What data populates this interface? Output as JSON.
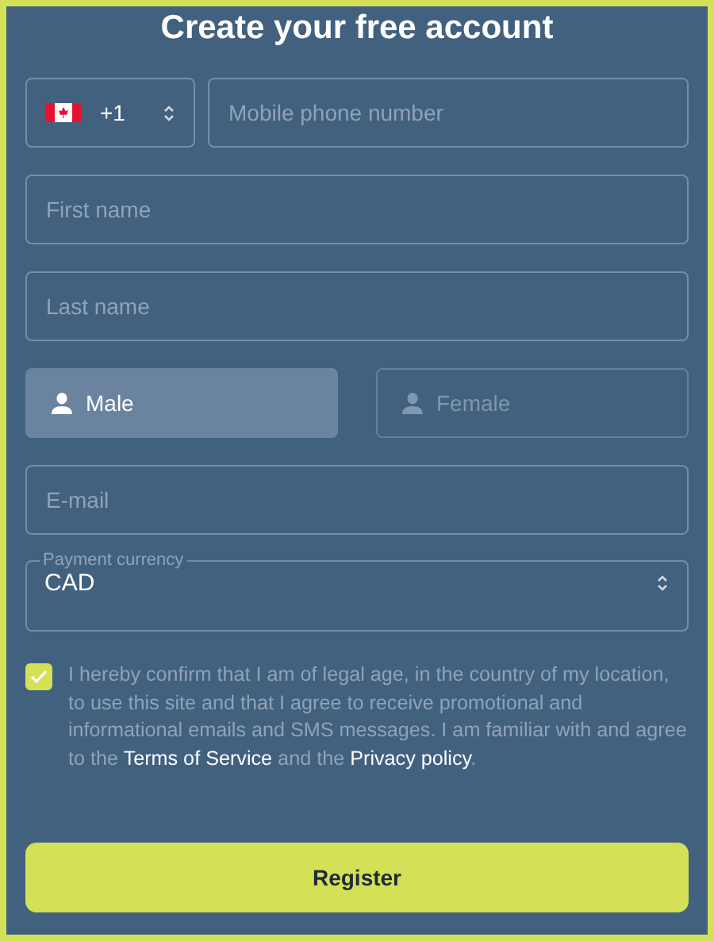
{
  "title": "Create your free account",
  "phone": {
    "country_code": "+1",
    "placeholder": "Mobile phone number"
  },
  "first_name": {
    "placeholder": "First name"
  },
  "last_name": {
    "placeholder": "Last name"
  },
  "gender": [
    {
      "label": "Male",
      "selected": true
    },
    {
      "label": "Female",
      "selected": false
    }
  ],
  "email": {
    "placeholder": "E-mail"
  },
  "currency": {
    "label": "Payment currency",
    "value": "CAD"
  },
  "consent": {
    "checked": true,
    "parts": [
      {
        "kind": "text",
        "text": "I hereby confirm that I am of legal age, in the country of my location, to use this site and that I agree to receive promotional and informational emails and SMS messages. I am familiar with and agree to the "
      },
      {
        "kind": "link",
        "text": "Terms of Service"
      },
      {
        "kind": "text",
        "text": " and the "
      },
      {
        "kind": "link",
        "text": "Privacy policy"
      },
      {
        "kind": "text",
        "text": "."
      }
    ]
  },
  "register_button": "Register"
}
